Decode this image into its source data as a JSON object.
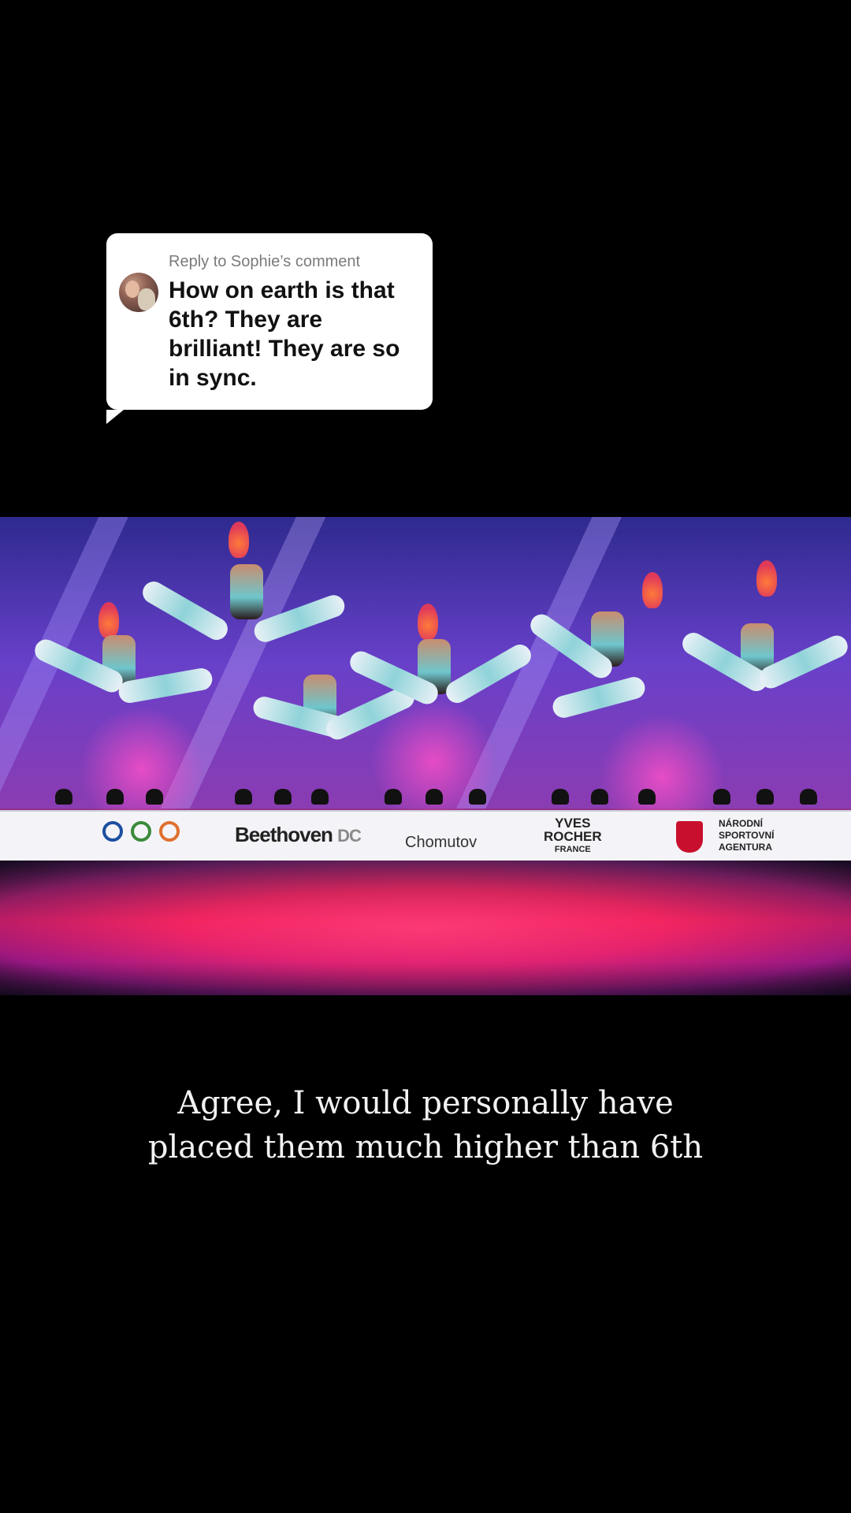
{
  "reply": {
    "header": "Reply to Sophie’s comment",
    "comment_lines": [
      "How on earth is that",
      "6th? They are",
      "brilliant! They are so",
      "in sync."
    ]
  },
  "video": {
    "sponsors": {
      "beethoven": "Beethoven",
      "beethoven_sub": "DC",
      "chomutov": "Chomutov",
      "yves_line1": "YVES",
      "yves_line2": "ROCHER",
      "yves_line3": "FRANCE",
      "narodni_line1": "NÁRODNÍ",
      "narodni_line2": "SPORTOVNÍ",
      "narodni_line3": "AGENTURA"
    }
  },
  "caption": {
    "line1": "Agree, I would personally have",
    "line2": "placed them much higher than 6th"
  }
}
